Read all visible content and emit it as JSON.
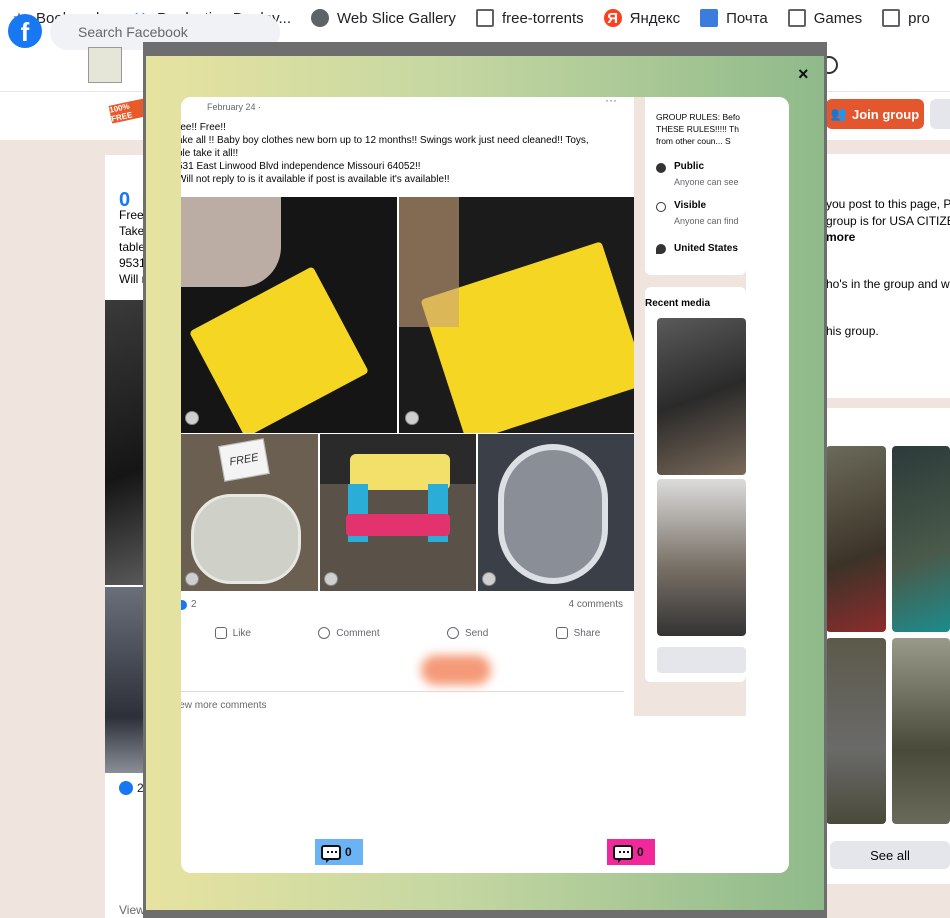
{
  "bookmarks": [
    {
      "label": "Bookmarks",
      "icon": "star-icon"
    },
    {
      "label": "Production Deploy...",
      "icon": "jira-icon"
    },
    {
      "label": "Web Slice Gallery",
      "icon": "globe-icon"
    },
    {
      "label": "free-torrents",
      "icon": "folder-icon"
    },
    {
      "label": "Яндекс",
      "icon": "yandex-icon"
    },
    {
      "label": "Почта",
      "icon": "mail-icon"
    },
    {
      "label": "Games",
      "icon": "folder-icon"
    },
    {
      "label": "pro",
      "icon": "folder-icon"
    }
  ],
  "header": {
    "search_placeholder": "Search Facebook",
    "join_label": "Join group"
  },
  "background": {
    "left_post_count": "0",
    "left_post_lines": [
      "Free!",
      "Take",
      "table",
      "9531",
      "Will n"
    ],
    "left_like_count": "2",
    "left_view_more": "View more comments",
    "right_lines": [
      "you post to this page, P",
      "group is for USA CITIZEN",
      "more",
      "ho's in the group and w",
      "his group."
    ],
    "see_all": "See all"
  },
  "modal": {
    "close": "×",
    "post": {
      "date": "February 24 · ",
      "more": "···",
      "lines": [
        "ree!! Free!!",
        "ake all !! Baby boy clothes new born up to 12 months!! Swings work just need cleaned!! Toys,",
        "ble take it all!!",
        "531 East Linwood Blvd independence Missouri 64052!!",
        "Will not reply to is it available if post is available it's available!!"
      ],
      "photo_tag": "FREE",
      "reaction_count": "2",
      "comment_count": "4 comments",
      "actions": [
        "Like",
        "Comment",
        "Send",
        "Share"
      ],
      "view_more": "iew more comments"
    },
    "side": {
      "rules_lines": [
        "GROUP RULES: Befo",
        "THESE RULES!!!!! Th",
        "from other coun... S"
      ],
      "public_title": "Public",
      "public_sub": "Anyone can see",
      "visible_title": "Visible",
      "visible_sub": "Anyone can find",
      "location": "United States",
      "recent_media": "Recent media"
    },
    "badges": {
      "left_count": "0",
      "right_count": "0"
    }
  },
  "colors": {
    "facebook_blue": "#1877f2",
    "join_button": "#e4572e",
    "badge_blue": "#6ab4f5",
    "badge_pink": "#f0289a"
  }
}
